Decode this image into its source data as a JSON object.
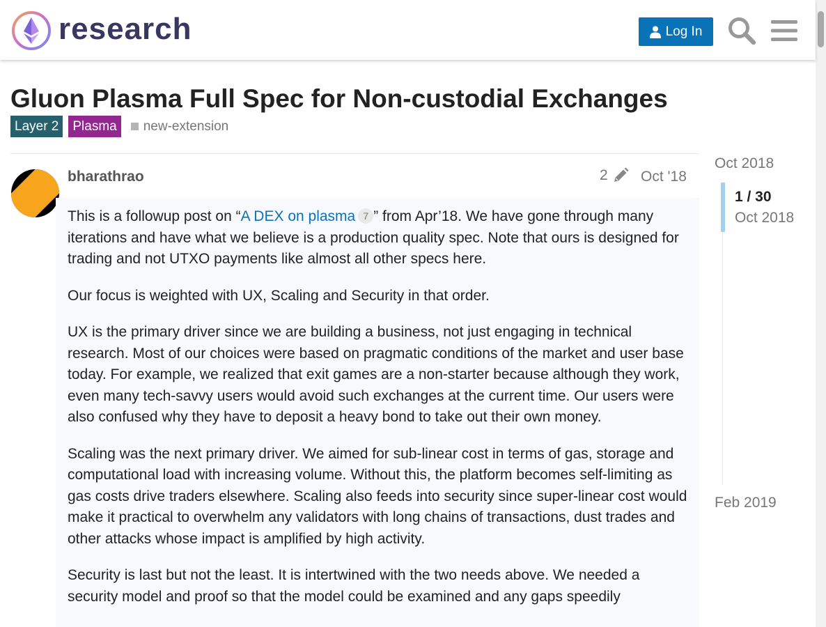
{
  "header": {
    "brand": "research",
    "login_label": "Log In",
    "icons": [
      "ethereum-logo",
      "user-icon",
      "search-icon",
      "menu-icon"
    ]
  },
  "topic": {
    "title": "Gluon Plasma Full Spec for Non-custodial Exchanges",
    "categories": [
      {
        "label": "Layer 2",
        "color": "#25606c"
      },
      {
        "label": "Plasma",
        "color": "#92278f"
      }
    ],
    "tag": "new-extension"
  },
  "post": {
    "username": "bharathrao",
    "edit_count": "2",
    "date": "Oct '18",
    "p1_before": "This is a followup post on “",
    "p1_link": "A DEX on plasma",
    "p1_link_clicks": "7",
    "p1_after": "” from Apr’18. We have gone through many iterations and have what we believe is a production quality spec. Note that ours is designed for trading and not UTXO payments like almost all other specs here.",
    "p2": "Our focus is weighted with UX, Scaling and Security in that order.",
    "p3": "UX is the primary driver since we are building a business, not just engaging in technical research. Most of our choices were based on pragmatic conditions of the market and user base today. For example, we realized that exit games are a non-starter because although they work, even many tech-savvy users would avoid such exchanges at the current time. Our users were also confused why they have to deposit a heavy bond to take out their own money.",
    "p4": "Scaling was the next primary driver. We aimed for sub-linear cost in terms of gas, storage and computational load with increasing volume. Without this, the platform becomes self-limiting as gas costs drive traders elsewhere. Scaling also feeds into security since super-linear cost would make it practical to overwhelm any validators with long chains of transactions, dust trades and other attacks whose impact is amplified by high activity.",
    "p5": "Security is last but not the least. It is intertwined with the two needs above. We needed a security model and proof so that the model could be examined and any gaps speedily"
  },
  "timeline": {
    "start": "Oct 2018",
    "position": "1 / 30",
    "current_date": "Oct 2018",
    "end": "Feb 2019"
  },
  "colors": {
    "accent": "#0a73b8",
    "layer2": "#25606c",
    "plasma": "#92278f",
    "timeline_handle": "#a3d1ed"
  }
}
